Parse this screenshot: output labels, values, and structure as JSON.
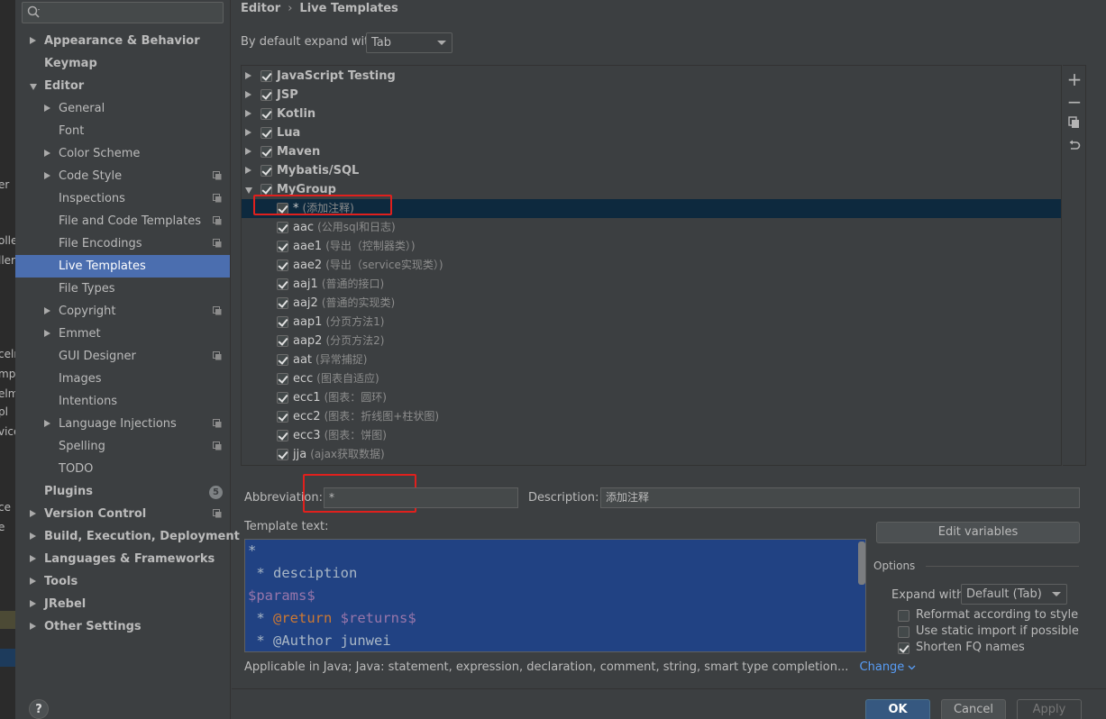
{
  "background_fragments": [
    "er",
    "olle",
    "ller",
    "celn",
    "mpl",
    "elm",
    "pl",
    "vice",
    "ce",
    "e"
  ],
  "sidebar": {
    "search_placeholder": "",
    "items": [
      {
        "label": "Appearance & Behavior",
        "expanded": false,
        "bold": true,
        "level": 0,
        "project_icon": false
      },
      {
        "label": "Keymap",
        "bold": true,
        "level": 0,
        "leaf": true,
        "project_icon": false
      },
      {
        "label": "Editor",
        "expanded": true,
        "bold": true,
        "level": 0,
        "project_icon": false
      },
      {
        "label": "General",
        "expanded": false,
        "level": 1,
        "project_icon": false
      },
      {
        "label": "Font",
        "level": 1,
        "leaf": true,
        "project_icon": false
      },
      {
        "label": "Color Scheme",
        "expanded": false,
        "level": 1,
        "project_icon": false
      },
      {
        "label": "Code Style",
        "expanded": false,
        "level": 1,
        "project_icon": true
      },
      {
        "label": "Inspections",
        "level": 1,
        "leaf": true,
        "project_icon": true
      },
      {
        "label": "File and Code Templates",
        "level": 1,
        "leaf": true,
        "project_icon": true
      },
      {
        "label": "File Encodings",
        "level": 1,
        "leaf": true,
        "project_icon": true
      },
      {
        "label": "Live Templates",
        "level": 1,
        "leaf": true,
        "selected": true,
        "project_icon": false
      },
      {
        "label": "File Types",
        "level": 1,
        "leaf": true,
        "project_icon": false
      },
      {
        "label": "Copyright",
        "expanded": false,
        "level": 1,
        "project_icon": true
      },
      {
        "label": "Emmet",
        "expanded": false,
        "level": 1,
        "project_icon": false
      },
      {
        "label": "GUI Designer",
        "level": 1,
        "leaf": true,
        "project_icon": true
      },
      {
        "label": "Images",
        "level": 1,
        "leaf": true,
        "project_icon": false
      },
      {
        "label": "Intentions",
        "level": 1,
        "leaf": true,
        "project_icon": false
      },
      {
        "label": "Language Injections",
        "expanded": false,
        "level": 1,
        "project_icon": true
      },
      {
        "label": "Spelling",
        "level": 1,
        "leaf": true,
        "project_icon": true
      },
      {
        "label": "TODO",
        "level": 1,
        "leaf": true,
        "project_icon": false
      },
      {
        "label": "Plugins",
        "bold": true,
        "level": 0,
        "leaf": true,
        "badge": "5",
        "project_icon": false
      },
      {
        "label": "Version Control",
        "expanded": false,
        "bold": true,
        "level": 0,
        "project_icon": true
      },
      {
        "label": "Build, Execution, Deployment",
        "expanded": false,
        "bold": true,
        "level": 0,
        "project_icon": false
      },
      {
        "label": "Languages & Frameworks",
        "expanded": false,
        "bold": true,
        "level": 0,
        "project_icon": false
      },
      {
        "label": "Tools",
        "expanded": false,
        "bold": true,
        "level": 0,
        "project_icon": false
      },
      {
        "label": "JRebel",
        "expanded": false,
        "bold": true,
        "level": 0,
        "project_icon": false
      },
      {
        "label": "Other Settings",
        "expanded": false,
        "bold": true,
        "level": 0,
        "project_icon": false
      }
    ],
    "help_label": "?"
  },
  "breadcrumb": {
    "parent": "Editor",
    "separator": "›",
    "current": "Live Templates"
  },
  "expand_with": {
    "label": "By default expand with",
    "value": "Tab"
  },
  "template_groups": [
    {
      "name": "JavaScript Testing",
      "checked": true,
      "expanded": false
    },
    {
      "name": "JSP",
      "checked": true,
      "expanded": false
    },
    {
      "name": "Kotlin",
      "checked": true,
      "expanded": false
    },
    {
      "name": "Lua",
      "checked": true,
      "expanded": false
    },
    {
      "name": "Maven",
      "checked": true,
      "expanded": false
    },
    {
      "name": "Mybatis/SQL",
      "checked": true,
      "expanded": false
    },
    {
      "name": "MyGroup",
      "checked": true,
      "expanded": true
    }
  ],
  "templates": [
    {
      "abbr": "*",
      "desc": "(添加注释)",
      "checked": true,
      "selected": true
    },
    {
      "abbr": "aac",
      "desc": "(公用sql和日志)",
      "checked": true
    },
    {
      "abbr": "aae1",
      "desc": "(导出（控制器类）)",
      "checked": true
    },
    {
      "abbr": "aae2",
      "desc": "(导出（service实现类）)",
      "checked": true
    },
    {
      "abbr": "aaj1",
      "desc": "(普通的接口)",
      "checked": true
    },
    {
      "abbr": "aaj2",
      "desc": "(普通的实现类)",
      "checked": true
    },
    {
      "abbr": "aap1",
      "desc": "(分页方法1)",
      "checked": true
    },
    {
      "abbr": "aap2",
      "desc": "(分页方法2)",
      "checked": true
    },
    {
      "abbr": "aat",
      "desc": "(异常捕捉)",
      "checked": true
    },
    {
      "abbr": "ecc",
      "desc": "(图表自适应)",
      "checked": true
    },
    {
      "abbr": "ecc1",
      "desc": "(图表：圆环)",
      "checked": true
    },
    {
      "abbr": "ecc2",
      "desc": "(图表：折线图+柱状图)",
      "checked": true
    },
    {
      "abbr": "ecc3",
      "desc": "(图表：饼图)",
      "checked": true
    },
    {
      "abbr": "jja",
      "desc": "(ajax获取数据)",
      "checked": true
    }
  ],
  "toolbar": {
    "add": "+",
    "remove": "−",
    "copy_icon": "copy-icon",
    "restore_icon": "undo-icon"
  },
  "editor": {
    "abbreviation_label": "Abbreviation:",
    "abbreviation_value": "*",
    "description_label": "Description:",
    "description_value": "添加注释",
    "template_text_label": "Template text:",
    "template_lines": [
      {
        "parts": [
          {
            "t": "*",
            "c": "plain"
          }
        ]
      },
      {
        "parts": [
          {
            "t": " * desciption",
            "c": "plain"
          }
        ]
      },
      {
        "parts": [
          {
            "t": "$params$",
            "c": "var"
          }
        ]
      },
      {
        "parts": [
          {
            "t": " * ",
            "c": "plain"
          },
          {
            "t": "@return",
            "c": "kw"
          },
          {
            "t": " ",
            "c": "plain"
          },
          {
            "t": "$returns$",
            "c": "var"
          }
        ]
      },
      {
        "parts": [
          {
            "t": " * ",
            "c": "plain"
          },
          {
            "t": "@Author",
            "c": "plain"
          },
          {
            "t": " junwei",
            "c": "plain"
          }
        ]
      }
    ],
    "edit_variables": "Edit variables",
    "options_title": "Options",
    "expand_with_label": "Expand with",
    "expand_with_value": "Default (Tab)",
    "options": [
      {
        "label": "Reformat according to style",
        "checked": false
      },
      {
        "label": "Use static import if possible",
        "checked": false
      },
      {
        "label": "Shorten FQ names",
        "checked": true
      }
    ],
    "applicable_text": "Applicable in Java; Java: statement, expression, declaration, comment, string, smart type completion...",
    "change_link": "Change"
  },
  "buttons": {
    "ok": "OK",
    "cancel": "Cancel",
    "apply": "Apply"
  },
  "colors": {
    "selection": "#4b6eaf",
    "tree_selection": "#0d293e",
    "template_bg": "#214283",
    "highlight_box": "#e0201d",
    "link": "#589df6"
  }
}
